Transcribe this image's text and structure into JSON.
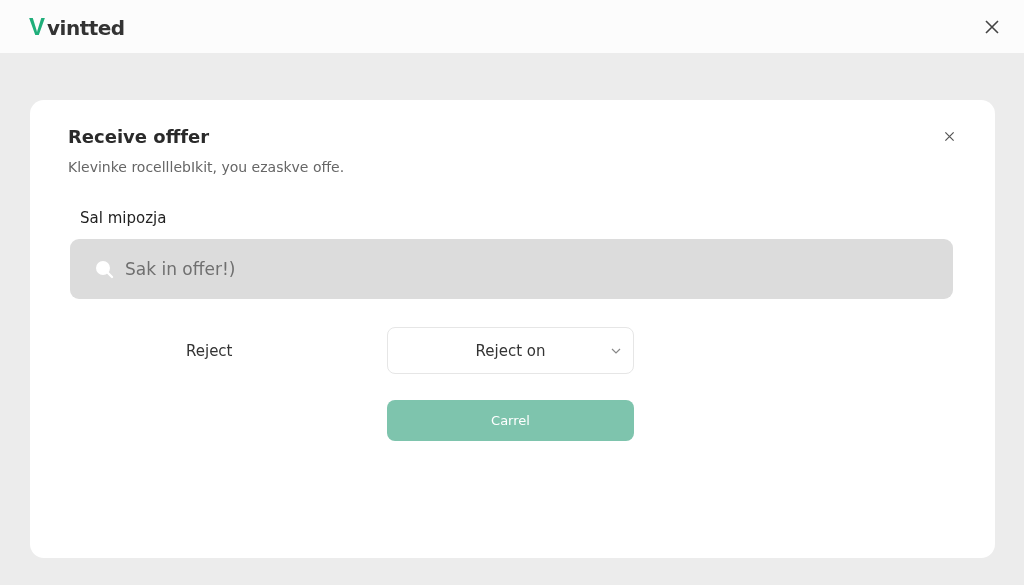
{
  "header": {
    "logo_mark": "V",
    "logo_text": "vintted"
  },
  "dialog": {
    "title": "Receive offfer",
    "subtitle": "Klevinke rocelllebIkit, you ezaskve offe.",
    "field_label": "Sal mipozja",
    "search": {
      "placeholder": "Sak in offer!)"
    },
    "reject_label": "Reject",
    "select": {
      "value": "Reject on"
    },
    "button": "Carrel"
  }
}
